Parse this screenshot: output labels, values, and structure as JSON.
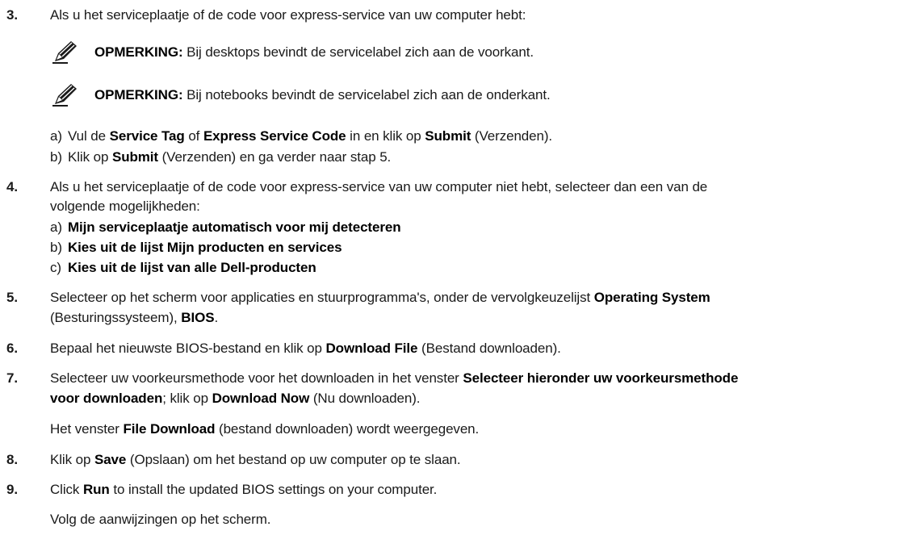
{
  "steps": {
    "s3": {
      "num": "3.",
      "text": "Als u het serviceplaatje of de code voor express-service van uw computer hebt:",
      "notes": [
        {
          "label": "OPMERKING:",
          "text": " Bij desktops bevindt de servicelabel zich aan de voorkant."
        },
        {
          "label": "OPMERKING:",
          "text": " Bij notebooks bevindt de servicelabel zich aan de onderkant."
        }
      ],
      "a": {
        "lbl": "a)",
        "t1": "Vul de ",
        "b1": "Service Tag",
        "t2": " of ",
        "b2": "Express Service Code",
        "t3": " in en klik op ",
        "b3": "Submit",
        "t4": " (Verzenden)."
      },
      "b": {
        "lbl": "b)",
        "t1": "Klik op ",
        "b1": "Submit",
        "t2": " (Verzenden) en ga verder naar stap 5."
      }
    },
    "s4": {
      "num": "4.",
      "line1": "Als u het serviceplaatje of de code voor express-service van uw computer niet hebt, selecteer dan een van de",
      "line2": "volgende mogelijkheden:",
      "a": {
        "lbl": "a)",
        "b": "Mijn serviceplaatje automatisch voor mij detecteren"
      },
      "b": {
        "lbl": "b)",
        "b": "Kies uit de lijst Mijn producten en services"
      },
      "c": {
        "lbl": "c)",
        "b": "Kies uit de lijst van alle Dell-producten"
      }
    },
    "s5": {
      "num": "5.",
      "l1_t1": "Selecteer op het scherm voor applicaties en stuurprogramma's, onder de vervolgkeuzelijst ",
      "l1_b1": "Operating System",
      "l2_t1": "(Besturingssysteem), ",
      "l2_b1": "BIOS",
      "l2_t2": "."
    },
    "s6": {
      "num": "6.",
      "t1": "Bepaal het nieuwste BIOS-bestand en klik op ",
      "b1": "Download File",
      "t2": " (Bestand downloaden)."
    },
    "s7": {
      "num": "7.",
      "l1_t1": "Selecteer uw voorkeursmethode voor het downloaden in het venster ",
      "l1_b1": "Selecteer hieronder uw voorkeursmethode",
      "l2_b1": "voor downloaden",
      "l2_t1": "; klik op ",
      "l2_b2": "Download Now",
      "l2_t2": " (Nu downloaden).",
      "p_t1": "Het venster ",
      "p_b1": "File Download",
      "p_t2": " (bestand downloaden) wordt weergegeven."
    },
    "s8": {
      "num": "8.",
      "t1": "Klik op ",
      "b1": "Save",
      "t2": " (Opslaan) om het bestand op uw computer op te slaan."
    },
    "s9": {
      "num": "9.",
      "t1": "Click ",
      "b1": "Run",
      "t2": " to install the updated BIOS settings on your computer.",
      "p": "Volg de aanwijzingen op het scherm."
    }
  }
}
